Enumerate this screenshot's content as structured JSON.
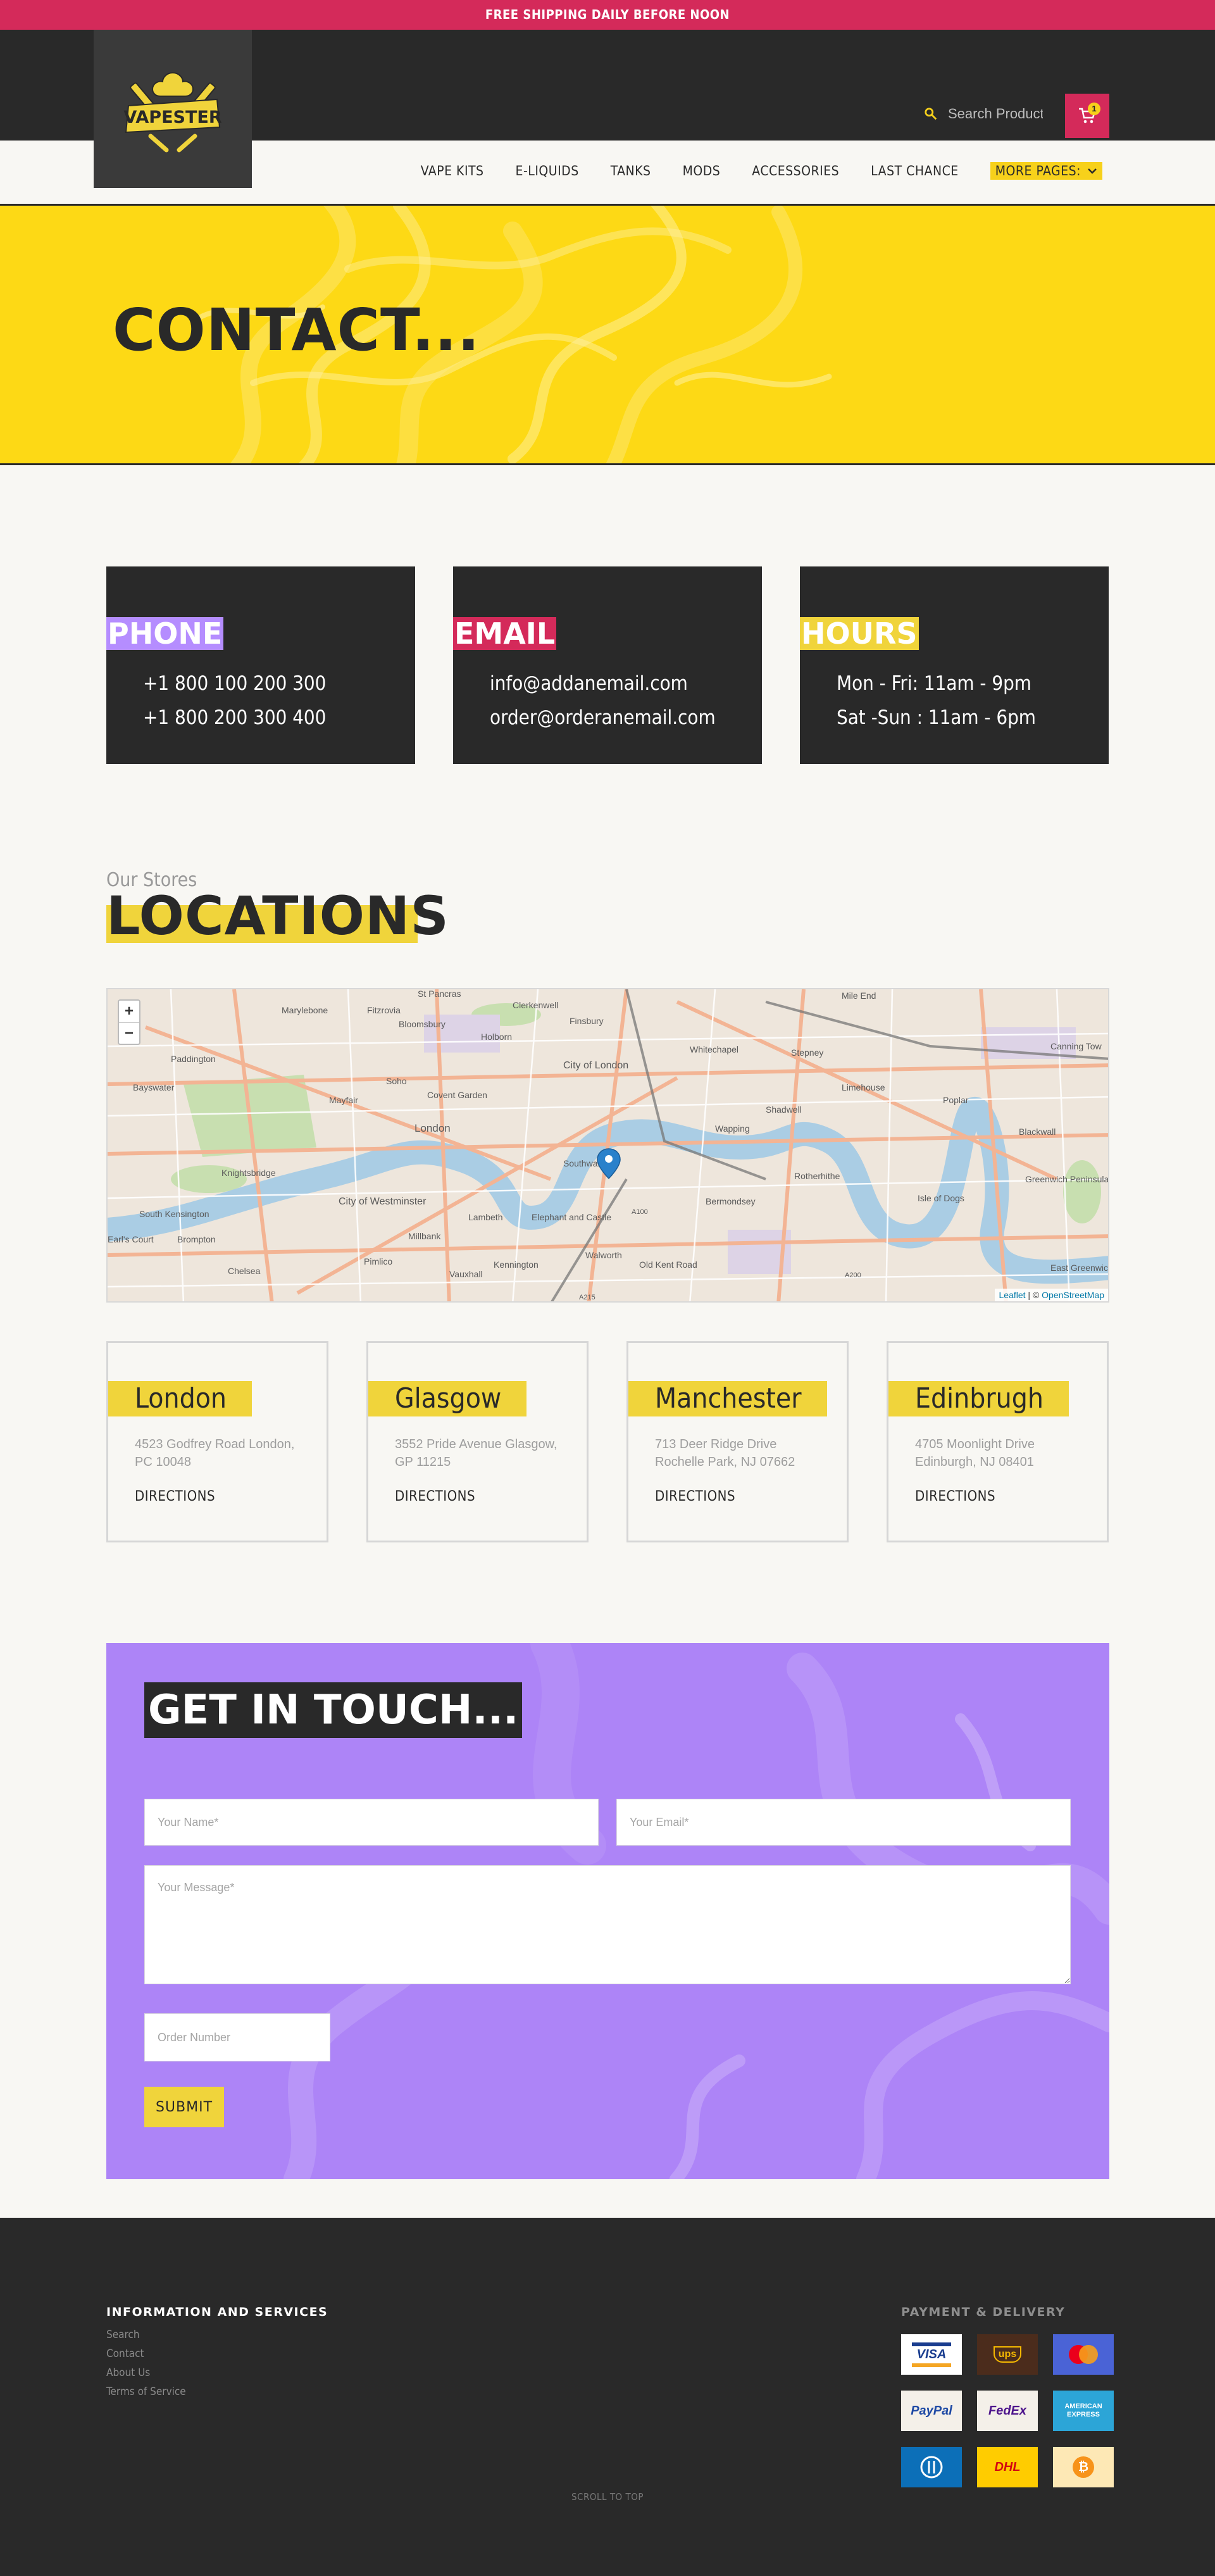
{
  "topbar": {
    "text": "FREE SHIPPING DAILY BEFORE NOON"
  },
  "header": {
    "logo_text": "VAPESTER",
    "search_placeholder": "Search Products...",
    "cart_count": "1"
  },
  "nav": {
    "items": [
      "VAPE KITS",
      "E-LIQUIDS",
      "TANKS",
      "MODS",
      "ACCESSORIES",
      "LAST CHANCE"
    ],
    "more_label": "MORE PAGES:"
  },
  "hero": {
    "title": "CONTACT..."
  },
  "info_cards": [
    {
      "label": "PHONE",
      "color": "#b58dff",
      "lines": [
        "+1 800 100 200 300",
        "+1 800 200 300 400"
      ]
    },
    {
      "label": "EMAIL",
      "color": "#d42a5a",
      "lines": [
        "info@addanemail.com",
        "order@orderanemail.com"
      ]
    },
    {
      "label": "HOURS",
      "color": "#f0d43b",
      "lines": [
        "Mon - Fri: 11am - 9pm",
        "Sat -Sun : 11am - 6pm"
      ]
    }
  ],
  "locations": {
    "subtitle": "Our Stores",
    "title": "LOCATIONS"
  },
  "map": {
    "zoom_in": "+",
    "zoom_out": "−",
    "attribution_leaflet": "Leaflet",
    "attribution_sep": " | © ",
    "attribution_osm": "OpenStreetMap",
    "labels": [
      "St Pancras",
      "Clerkenwell",
      "Finsbury",
      "Mile End",
      "Marylebone",
      "Fitzrovia",
      "Bloomsbury",
      "Holborn",
      "Whitechapel",
      "Stepney",
      "Canning Tow",
      "Paddington",
      "City of London",
      "Bayswater",
      "Soho",
      "Covent Garden",
      "Limehouse",
      "Poplar",
      "Mayfair",
      "London",
      "Wapping",
      "Shadwell",
      "Blackwall",
      "Knightsbridge",
      "Rotherhithe",
      "Greenwich Peninsula",
      "City of Westminster",
      "Southwark",
      "Bermondsey",
      "Isle of Dogs",
      "South Kensington",
      "Lambeth",
      "Elephant and Castle",
      "Millbank",
      "Brompton",
      "Pimlico",
      "Walworth",
      "Old Kent Road",
      "Chelsea",
      "Kennington",
      "Vauxhall",
      "East Greenwich",
      "Earl's Court",
      "A100",
      "A200",
      "A215"
    ]
  },
  "stores": [
    {
      "city": "London",
      "addr1": "4523 Godfrey Road London,",
      "addr2": "PC 10048",
      "dir": "DIRECTIONS"
    },
    {
      "city": "Glasgow",
      "addr1": "3552 Pride Avenue Glasgow,",
      "addr2": "GP 11215",
      "dir": "DIRECTIONS"
    },
    {
      "city": "Manchester",
      "addr1": "713 Deer Ridge Drive",
      "addr2": "Rochelle Park, NJ 07662",
      "dir": "DIRECTIONS"
    },
    {
      "city": "Edinbrugh",
      "addr1": "4705 Moonlight Drive",
      "addr2": "Edinburgh, NJ 08401",
      "dir": "DIRECTIONS"
    }
  ],
  "contact": {
    "title": "GET IN TOUCH...",
    "name_placeholder": "Your Name*",
    "email_placeholder": "Your Email*",
    "message_placeholder": "Your Message*",
    "order_placeholder": "Order Number",
    "submit": "SUBMIT"
  },
  "footer": {
    "info_title": "INFORMATION AND SERVICES",
    "links": [
      "Search",
      "Contact",
      "About Us",
      "Terms of Service"
    ],
    "pay_title": "PAYMENT & DELIVERY",
    "payments": [
      {
        "name": "visa-icon",
        "label": "VISA",
        "bg": "#ffffff",
        "fg": "#1a3d8f"
      },
      {
        "name": "ups-icon",
        "label": "ups",
        "bg": "#4b2c1c",
        "fg": "#f5b800"
      },
      {
        "name": "mastercard-icon",
        "label": "",
        "bg": "#4a63d6",
        "fg": "#ffffff"
      },
      {
        "name": "paypal-icon",
        "label": "PayPal",
        "bg": "#f4f0e9",
        "fg": "#1f4aa5"
      },
      {
        "name": "fedex-icon",
        "label": "FedEx",
        "bg": "#f4f0e9",
        "fg": "#4d148c"
      },
      {
        "name": "amex-icon",
        "label": "AMERICAN EXPRESS",
        "bg": "#2ca5d7",
        "fg": "#ffffff"
      },
      {
        "name": "diners-icon",
        "label": "",
        "bg": "#0c6fb8",
        "fg": "#ffffff"
      },
      {
        "name": "dhl-icon",
        "label": "DHL",
        "bg": "#ffcc00",
        "fg": "#d40511"
      },
      {
        "name": "bitcoin-icon",
        "label": "₿",
        "bg": "#fde8b5",
        "fg": "#f7931a"
      }
    ],
    "scroll_top": "SCROLL TO TOP"
  }
}
